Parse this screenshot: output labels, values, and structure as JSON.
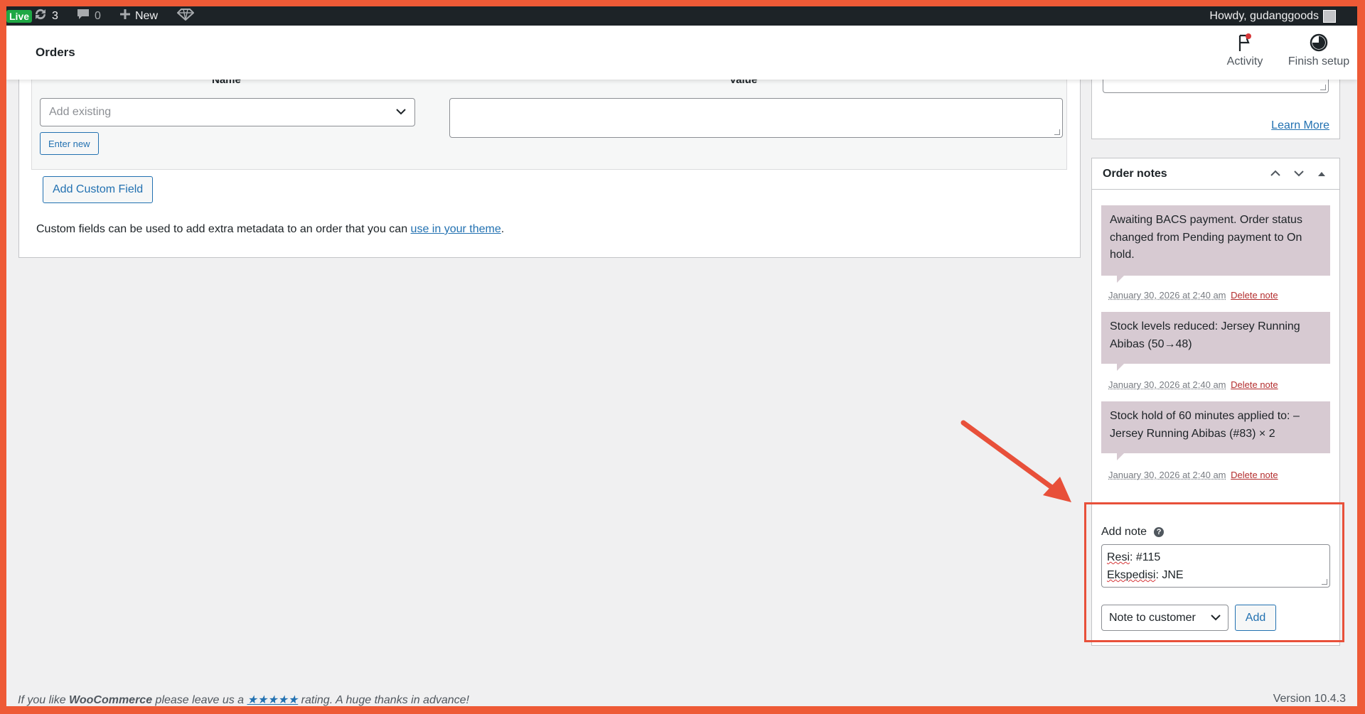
{
  "admin_bar": {
    "live_badge": "Live",
    "updates_count": "3",
    "comments_count": "0",
    "new_label": "New",
    "howdy": "Howdy, gudanggoods"
  },
  "header": {
    "title": "Orders",
    "activity_label": "Activity",
    "finish_setup_label": "Finish setup"
  },
  "custom_fields": {
    "col_name": "Name",
    "col_value": "Value",
    "add_existing_placeholder": "Add existing",
    "enter_new_label": "Enter new",
    "add_button": "Add Custom Field",
    "help_text_before": "Custom fields can be used to add extra metadata to an order that you can ",
    "help_link": "use in your theme",
    "help_text_after": "."
  },
  "sidebar_prev": {
    "learn_more": "Learn More"
  },
  "order_notes": {
    "title": "Order notes",
    "notes": [
      {
        "text": "Awaiting BACS payment. Order status changed from Pending payment to On hold.",
        "date": "January 30, 2026 at 2:40 am",
        "delete": "Delete note"
      },
      {
        "text": "Stock levels reduced: Jersey Running Abibas (50→48)",
        "date": "January 30, 2026 at 2:40 am",
        "delete": "Delete note"
      },
      {
        "text": "Stock hold of 60 minutes applied to: – Jersey Running Abibas (#83) × 2",
        "date": "January 30, 2026 at 2:40 am",
        "delete": "Delete note"
      }
    ],
    "add_note_label": "Add note",
    "note_line_1_word": "Resi",
    "note_line_1_rest": ": #115",
    "note_line_2_word": "Ekspedisi",
    "note_line_2_rest": ": JNE",
    "note_type_selected": "Note to customer",
    "add_button": "Add"
  },
  "footer": {
    "left_pre": "If you like ",
    "left_brand": "WooCommerce",
    "left_mid": " please leave us a ",
    "left_stars": "★★★★★",
    "left_post": " rating. A huge thanks in advance!",
    "version": "Version 10.4.3"
  },
  "colors": {
    "frame": "#ee5a36",
    "accent": "#2271b1",
    "note_bg": "#d7cad2",
    "highlight": "#e8503a"
  }
}
